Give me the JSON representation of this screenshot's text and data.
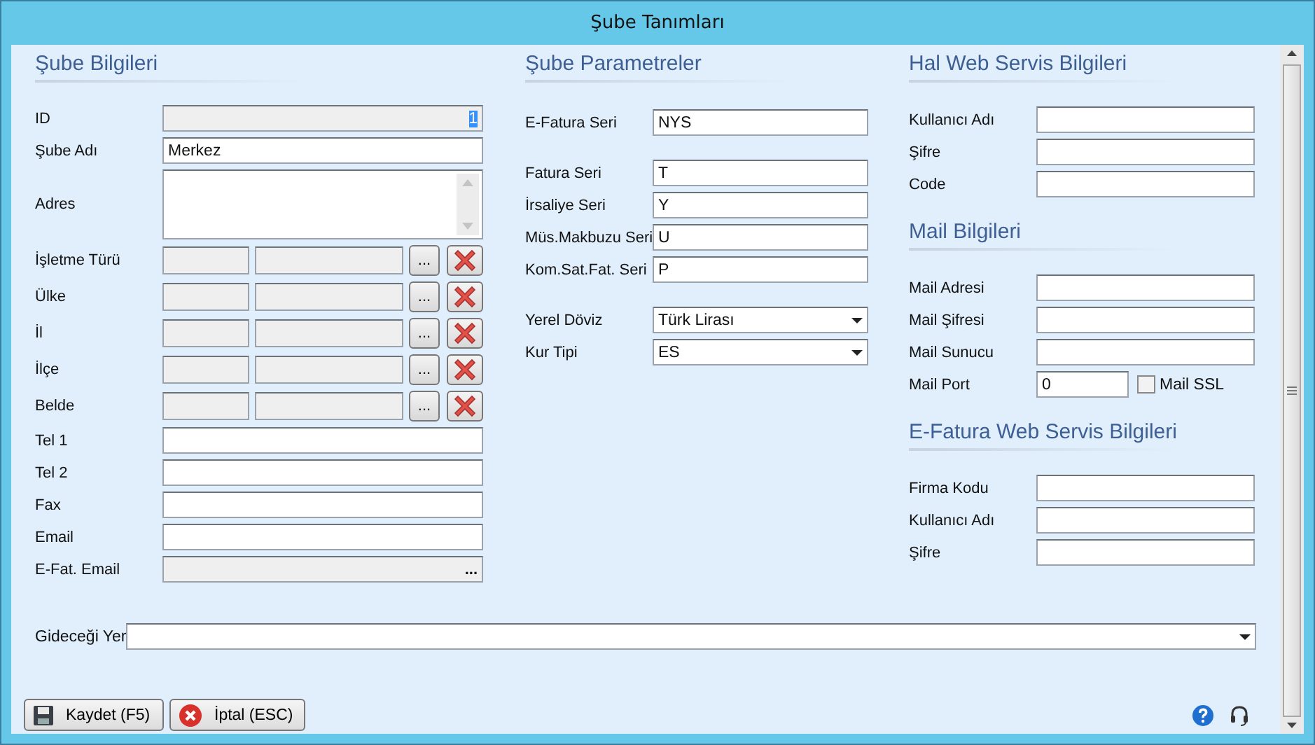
{
  "window": {
    "title": "Şube Tanımları"
  },
  "left": {
    "title": "Şube Bilgileri",
    "fields": [
      {
        "kind": "text",
        "label": "ID",
        "value": "1",
        "disabled": true,
        "highlighted": true
      },
      {
        "kind": "text",
        "label": "Şube Adı",
        "value": "Merkez",
        "disabled": false
      },
      {
        "kind": "textarea",
        "label": "Adres"
      },
      {
        "kind": "lookup",
        "label": "İşletme Türü",
        "button": "..."
      },
      {
        "kind": "lookup",
        "label": "Ülke",
        "button": "..."
      },
      {
        "kind": "lookup",
        "label": "İl",
        "button": "..."
      },
      {
        "kind": "lookup",
        "label": "İlçe",
        "button": "..."
      },
      {
        "kind": "lookup",
        "label": "Belde",
        "button": "..."
      },
      {
        "kind": "text",
        "label": "Tel 1",
        "disabled": false
      },
      {
        "kind": "text",
        "label": "Tel 2",
        "disabled": false
      },
      {
        "kind": "text",
        "label": "Fax",
        "disabled": false
      },
      {
        "kind": "text",
        "label": "Email",
        "disabled": false
      },
      {
        "kind": "ellipsis",
        "label": "E-Fat. Email",
        "button": "...",
        "disabled": true
      }
    ]
  },
  "middle": {
    "title": "Şube Parametreler",
    "groups": [
      [
        {
          "kind": "text",
          "label": "E-Fatura Seri",
          "value": "NYS"
        }
      ],
      [
        {
          "kind": "text",
          "label": "Fatura Seri",
          "value": "T"
        },
        {
          "kind": "text",
          "label": "İrsaliye Seri",
          "value": "Y"
        },
        {
          "kind": "text",
          "label": "Müs.Makbuzu Seri",
          "value": "U"
        },
        {
          "kind": "text",
          "label": "Kom.Sat.Fat. Seri",
          "value": "P"
        }
      ],
      [
        {
          "kind": "select",
          "label": "Yerel Döviz",
          "value": "Türk Lirası"
        },
        {
          "kind": "select",
          "label": "Kur Tipi",
          "value": "ES"
        }
      ]
    ]
  },
  "right": [
    {
      "title": "Hal Web Servis Bilgileri",
      "fields": [
        {
          "kind": "text",
          "label": "Kullanıcı Adı"
        },
        {
          "kind": "text",
          "label": "Şifre"
        },
        {
          "kind": "text",
          "label": "Code"
        }
      ]
    },
    {
      "title": "Mail Bilgileri",
      "fields": [
        {
          "kind": "text",
          "label": "Mail Adresi"
        },
        {
          "kind": "text",
          "label": "Mail Şifresi"
        },
        {
          "kind": "text",
          "label": "Mail Sunucu"
        },
        {
          "kind": "number_check",
          "label": "Mail Port",
          "value": "0",
          "check_label": "Mail SSL",
          "checked": false
        }
      ]
    },
    {
      "title": "E-Fatura Web Servis Bilgileri",
      "fields": [
        {
          "kind": "text",
          "label": "Firma Kodu"
        },
        {
          "kind": "text",
          "label": "Kullanıcı Adı"
        },
        {
          "kind": "text",
          "label": "Şifre"
        }
      ]
    }
  ],
  "destination": {
    "label": "Gideceği Yer"
  },
  "buttons": [
    {
      "kind": "save",
      "label": "Kaydet (F5)"
    },
    {
      "kind": "cancel",
      "label": "İptal (ESC)"
    }
  ]
}
